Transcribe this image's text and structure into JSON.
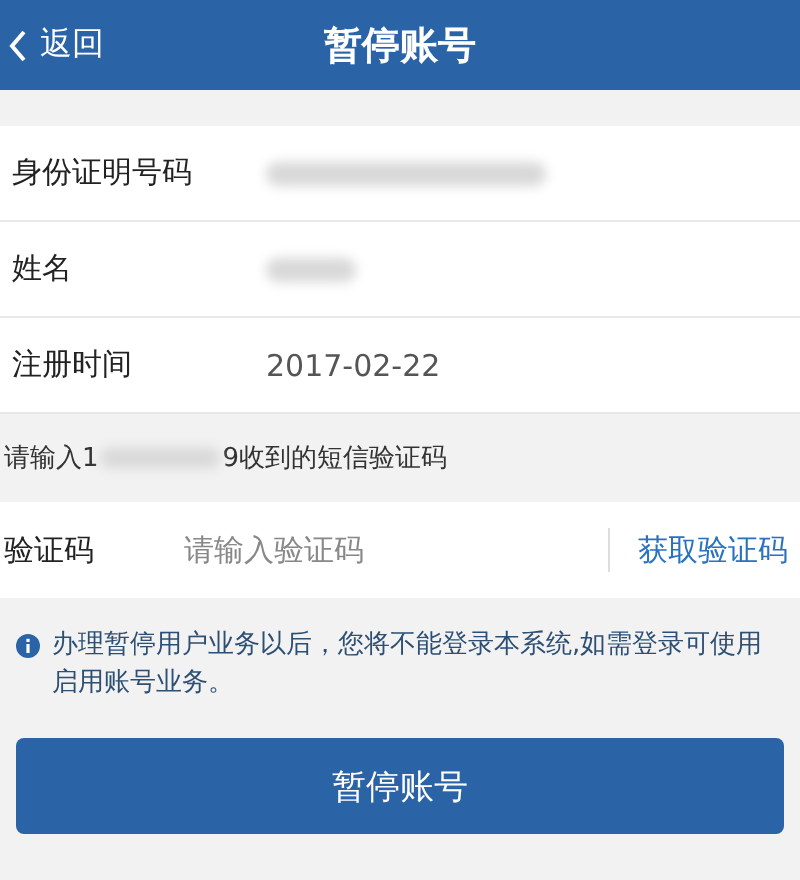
{
  "header": {
    "back": "返回",
    "title": "暂停账号"
  },
  "rows": [
    {
      "label": "身份证明号码",
      "kind": "redacted"
    },
    {
      "label": "姓名",
      "kind": "redacted"
    },
    {
      "label": "注册时间",
      "kind": "text",
      "value": "2017-02-22"
    }
  ],
  "sms_hint": {
    "prefix": "请输入1",
    "suffix": "9收到的短信验证码"
  },
  "code_field": {
    "label": "验证码",
    "placeholder": "请输入验证码",
    "link": "获取验证码"
  },
  "notice": "办理暂停用户业务以后，您将不能登录本系统,如需登录可使用启用账号业务。",
  "button": "暂停账号"
}
